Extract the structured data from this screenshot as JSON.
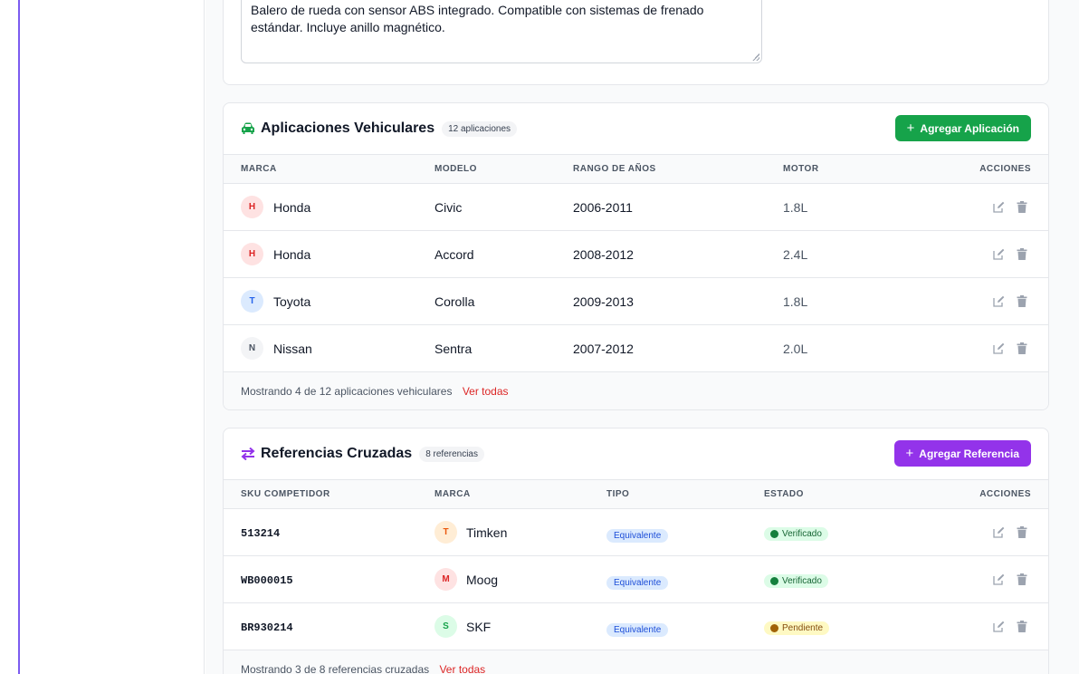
{
  "description": {
    "text": "Balero de rueda con sensor ABS integrado. Compatible con sistemas de frenado estándar. Incluye anillo magnético."
  },
  "applications": {
    "title": "Aplicaciones Vehiculares",
    "count_badge": "12 aplicaciones",
    "add_label": "Agregar Aplicación",
    "columns": [
      "MARCA",
      "MODELO",
      "RANGO DE AÑOS",
      "MOTOR",
      "ACCIONES"
    ],
    "rows": [
      {
        "initial": "H",
        "brand": "Honda",
        "model": "Civic",
        "years": "2006-2011",
        "engine": "1.8L"
      },
      {
        "initial": "H",
        "brand": "Honda",
        "model": "Accord",
        "years": "2008-2012",
        "engine": "2.4L"
      },
      {
        "initial": "T",
        "brand": "Toyota",
        "model": "Corolla",
        "years": "2009-2013",
        "engine": "1.8L"
      },
      {
        "initial": "N",
        "brand": "Nissan",
        "model": "Sentra",
        "years": "2007-2012",
        "engine": "2.0L"
      }
    ],
    "footer_text": "Mostrando 4 de 12 aplicaciones vehiculares",
    "footer_link": "Ver todas"
  },
  "references": {
    "title": "Referencias Cruzadas",
    "count_badge": "8 referencias",
    "add_label": "Agregar Referencia",
    "columns": [
      "SKU COMPETIDOR",
      "MARCA",
      "TIPO",
      "ESTADO",
      "ACCIONES"
    ],
    "rows": [
      {
        "sku": "513214",
        "initial": "T",
        "brand": "Timken",
        "type": "Equivalente",
        "status": "Verificado"
      },
      {
        "sku": "WB000015",
        "initial": "M",
        "brand": "Moog",
        "type": "Equivalente",
        "status": "Verificado"
      },
      {
        "sku": "BR930214",
        "initial": "S",
        "brand": "SKF",
        "type": "Equivalente",
        "status": "Pendiente"
      }
    ],
    "footer_text": "Mostrando 3 de 8 referencias cruzadas",
    "footer_link": "Ver todas"
  },
  "icons": {
    "applications_header": "car-icon",
    "references_header": "arrows-exchange-icon",
    "edit": "edit-icon",
    "delete": "trash-icon",
    "verified": "check-circle-icon",
    "pending": "clock-icon"
  },
  "colors": {
    "accent_purple": "#9333ea",
    "accent_green": "#16a34a",
    "link_red": "#dc2626",
    "frame_border": "#7c5cf0"
  }
}
